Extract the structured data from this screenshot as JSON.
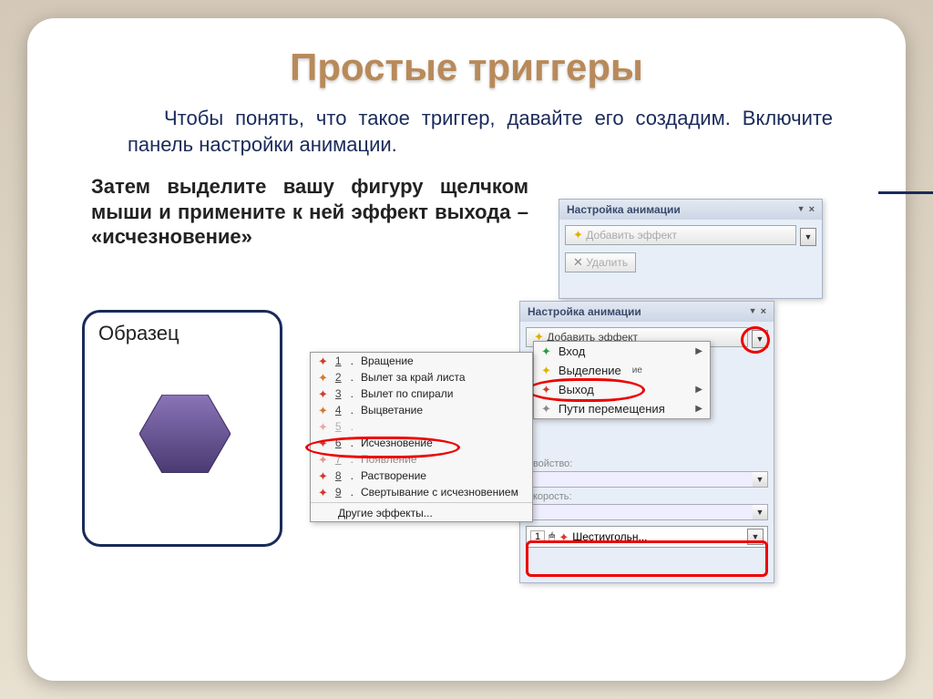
{
  "title": "Простые триггеры",
  "para1": "Чтобы понять, что такое триггер, давайте его создадим.  Включите панель настройки анимации.",
  "para2": "Затем выделите  вашу фигуру щелчком мыши и примените к ней эффект выхода – «исчезновение»",
  "sample_label": "Образец",
  "panel": {
    "title": "Настройка анимации",
    "add_effect": "Добавить эффект",
    "remove": "Удалить"
  },
  "submenu": {
    "entry": "Вход",
    "emphasis": "Выделение",
    "emphasis_suffix": "ие",
    "exit": "Выход",
    "motion": "Пути перемещения"
  },
  "front_panel": {
    "property": "Свойство:",
    "speed": "Скорость:",
    "object_num": "1",
    "object_name": "Шестиугольн..."
  },
  "effects": {
    "e1": "Вращение",
    "e2": "Вылет за край листа",
    "e3": "Вылет по спирали",
    "e4": "Выцветание",
    "e5": "",
    "e6": "Исчезновение",
    "e7": "Появление",
    "e8": "Растворение",
    "e9": "Свертывание с исчезновением",
    "other": "Другие эффекты..."
  }
}
